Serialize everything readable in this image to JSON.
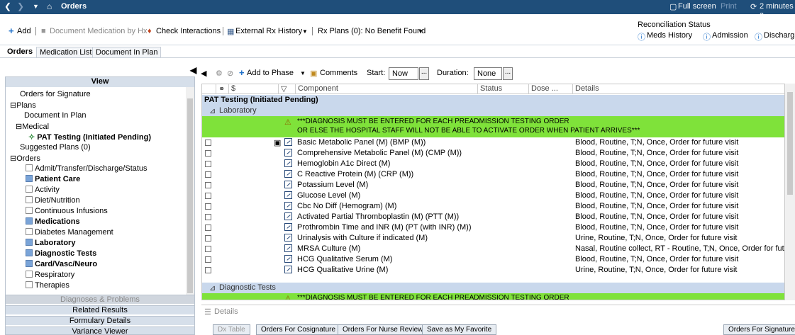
{
  "titlebar": {
    "title": "Orders",
    "fullscreen": "Full screen",
    "print": "Print",
    "elapsed": "2 minutes a"
  },
  "toolbar": {
    "add": "Add",
    "document_medication": "Document Medication by Hx",
    "check_interactions": "Check Interactions",
    "external_rx": "External Rx History",
    "rx_plans": "Rx Plans (0): No Benefit Found",
    "reconciliation_title": "Reconciliation Status",
    "meds_history": "Meds History",
    "admission": "Admission",
    "discharge": "Discharg"
  },
  "tabs": [
    {
      "label": "Orders"
    },
    {
      "label": "Medication List"
    },
    {
      "label": "Document In Plan"
    }
  ],
  "left": {
    "view_header": "View",
    "tree": [
      {
        "label": "Orders for Signature"
      },
      {
        "label": "Plans"
      },
      {
        "label": "Document In Plan"
      },
      {
        "label": "Medical"
      },
      {
        "label": "PAT Testing (Initiated Pending)"
      },
      {
        "label": "Suggested Plans (0)"
      },
      {
        "label": "Orders"
      },
      {
        "label": "Admit/Transfer/Discharge/Status"
      },
      {
        "label": "Patient Care"
      },
      {
        "label": "Activity"
      },
      {
        "label": "Diet/Nutrition"
      },
      {
        "label": "Continuous Infusions"
      },
      {
        "label": "Medications"
      },
      {
        "label": "Diabetes Management"
      },
      {
        "label": "Laboratory"
      },
      {
        "label": "Diagnostic Tests"
      },
      {
        "label": "Card/Vasc/Neuro"
      },
      {
        "label": "Respiratory"
      },
      {
        "label": "Therapies"
      }
    ],
    "buttons": [
      {
        "label": "Diagnoses & Problems"
      },
      {
        "label": "Related Results"
      },
      {
        "label": "Formulary Details"
      },
      {
        "label": "Variance Viewer"
      }
    ]
  },
  "rtoolbar": {
    "add_to_phase": "Add to Phase",
    "comments": "Comments",
    "start_label": "Start:",
    "start_value": "Now",
    "duration_label": "Duration:",
    "duration_value": "None"
  },
  "grid": {
    "headers": {
      "dollar": "$",
      "component": "Component",
      "status": "Status",
      "dose": "Dose ...",
      "details": "Details"
    },
    "plan_title": "PAT Testing (Initiated Pending)",
    "section_lab": "Laboratory",
    "note_line1": "***DIAGNOSIS MUST BE ENTERED FOR EACH PREADMISSION TESTING ORDER",
    "note_line2": "OR ELSE THE HOSPITAL STAFF WILL NOT BE ABLE TO ACTIVATE ORDER WHEN PATIENT ARRIVES***",
    "rows": [
      {
        "component": "Basic Metabolic Panel (M) (BMP (M))",
        "details": "Blood, Routine, T;N, Once, Order for future visit"
      },
      {
        "component": "Comprehensive Metabolic Panel (M) (CMP (M))",
        "details": "Blood, Routine, T;N, Once, Order for future visit"
      },
      {
        "component": "Hemoglobin A1c Direct (M)",
        "details": "Blood, Routine, T;N, Once, Order for future visit"
      },
      {
        "component": "C Reactive Protein (M) (CRP (M))",
        "details": "Blood, Routine, T;N, Once, Order for future visit"
      },
      {
        "component": "Potassium Level  (M)",
        "details": "Blood, Routine, T;N, Once, Order for future visit"
      },
      {
        "component": "Glucose Level  (M)",
        "details": "Blood, Routine, T;N, Once, Order for future visit"
      },
      {
        "component": "Cbc No Diff (Hemogram) (M)",
        "details": "Blood, Routine, T;N, Once, Order for future visit"
      },
      {
        "component": "Activated Partial Thromboplastin (M) (PTT (M))",
        "details": "Blood, Routine, T;N, Once, Order for future visit"
      },
      {
        "component": "Prothrombin Time and INR  (M) (PT (with INR)  (M))",
        "details": "Blood, Routine, T;N, Once, Order for future visit"
      },
      {
        "component": "Urinalysis with Culture if indicated (M)",
        "details": "Urine, Routine, T;N, Once, Order for future visit"
      },
      {
        "component": "MRSA Culture (M)",
        "details": "Nasal, Routine collect, RT - Routine, T;N, Once, Order for fut..."
      },
      {
        "component": "HCG Qualitative Serum  (M)",
        "details": "Blood, Routine, T;N, Once, Order for future visit"
      },
      {
        "component": "HCG Qualitative Urine  (M)",
        "details": "Urine, Routine, T;N, Once, Order for future visit"
      }
    ],
    "section_diag": "Diagnostic Tests",
    "note_line3": "***DIAGNOSIS MUST BE ENTERED FOR EACH PREADMISSION TESTING ORDER"
  },
  "details_label": "Details",
  "bottom": {
    "dx_table": "Dx Table",
    "cosignature": "Orders For Cosignature",
    "nurse_review": "Orders For Nurse Review",
    "favorite": "Save as My Favorite",
    "signature": "Orders For Signature"
  },
  "colors": {
    "titlebar": "#1f4e7a",
    "note_green": "#7fe23a",
    "section_blue": "#c9d8ec"
  }
}
